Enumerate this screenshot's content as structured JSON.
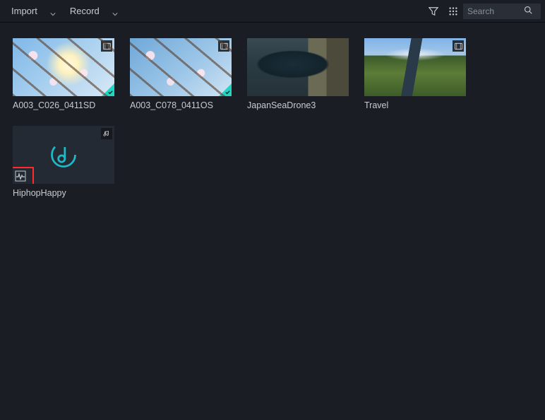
{
  "toolbar": {
    "import_label": "Import",
    "record_label": "Record",
    "search_placeholder": "Search"
  },
  "items": [
    {
      "label": "A003_C026_0411SD",
      "type": "video",
      "checked": true,
      "thumbClass": "sky1"
    },
    {
      "label": "A003_C078_0411OS",
      "type": "video",
      "checked": true,
      "thumbClass": "sky2"
    },
    {
      "label": "JapanSeaDrone3",
      "type": "video",
      "checked": false,
      "thumbClass": "drone"
    },
    {
      "label": "Travel",
      "type": "video",
      "checked": false,
      "thumbClass": "travel"
    },
    {
      "label": "HiphopHappy",
      "type": "audio",
      "checked": false,
      "highlighted": true
    }
  ]
}
